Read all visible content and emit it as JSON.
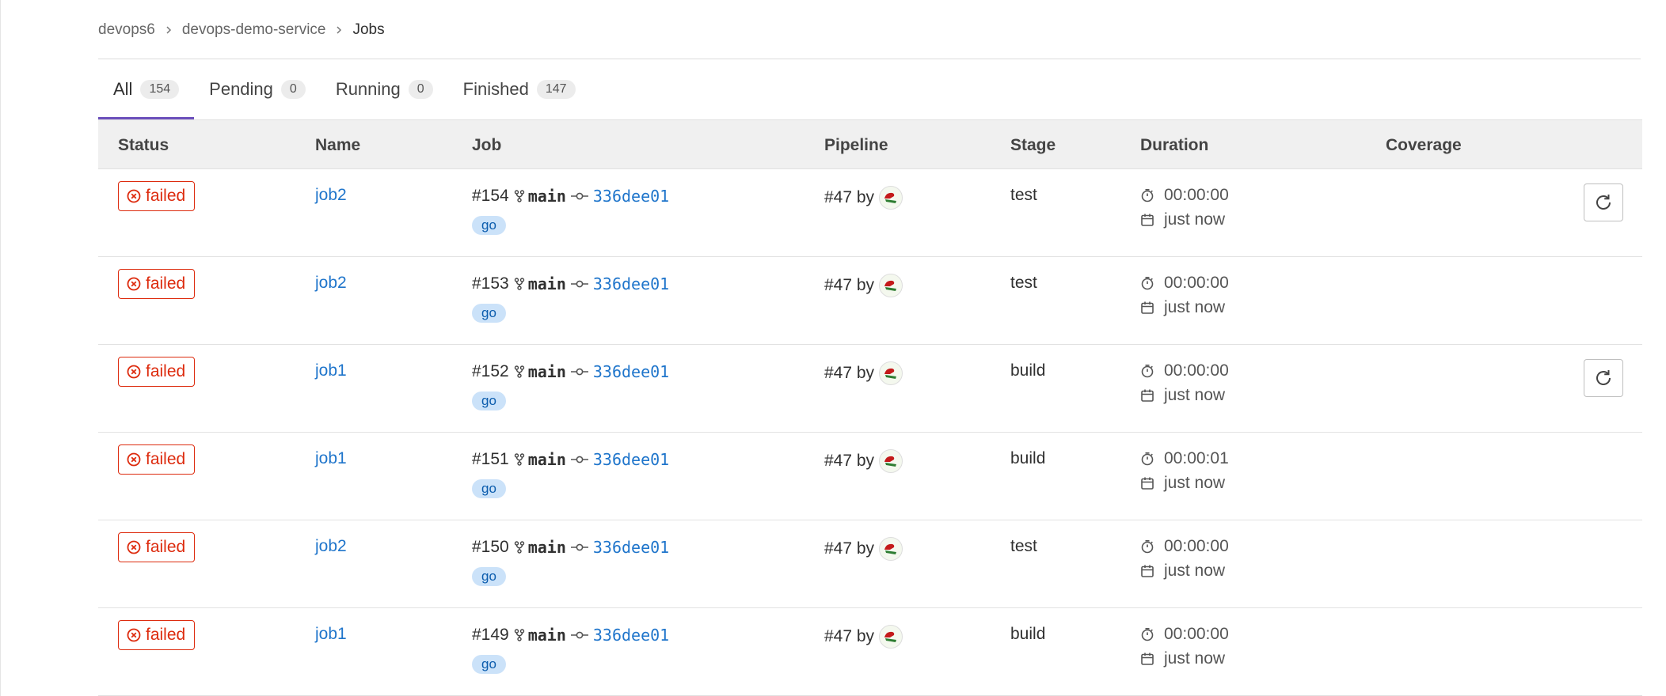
{
  "breadcrumb": [
    "devops6",
    "devops-demo-service",
    "Jobs"
  ],
  "tabs": [
    {
      "label": "All",
      "count": "154"
    },
    {
      "label": "Pending",
      "count": "0"
    },
    {
      "label": "Running",
      "count": "0"
    },
    {
      "label": "Finished",
      "count": "147"
    }
  ],
  "columns": {
    "status": "Status",
    "name": "Name",
    "job": "Job",
    "pipeline": "Pipeline",
    "stage": "Stage",
    "duration": "Duration",
    "coverage": "Coverage"
  },
  "rows": [
    {
      "status": "failed",
      "name": "job2",
      "id": "#154",
      "ref": "main",
      "sha": "336dee01",
      "tag": "go",
      "pipeline": "#47 by",
      "stage": "test",
      "duration": "00:00:00",
      "finished": "just now",
      "retry": true
    },
    {
      "status": "failed",
      "name": "job2",
      "id": "#153",
      "ref": "main",
      "sha": "336dee01",
      "tag": "go",
      "pipeline": "#47 by",
      "stage": "test",
      "duration": "00:00:00",
      "finished": "just now",
      "retry": false
    },
    {
      "status": "failed",
      "name": "job1",
      "id": "#152",
      "ref": "main",
      "sha": "336dee01",
      "tag": "go",
      "pipeline": "#47 by",
      "stage": "build",
      "duration": "00:00:00",
      "finished": "just now",
      "retry": true
    },
    {
      "status": "failed",
      "name": "job1",
      "id": "#151",
      "ref": "main",
      "sha": "336dee01",
      "tag": "go",
      "pipeline": "#47 by",
      "stage": "build",
      "duration": "00:00:01",
      "finished": "just now",
      "retry": false
    },
    {
      "status": "failed",
      "name": "job2",
      "id": "#150",
      "ref": "main",
      "sha": "336dee01",
      "tag": "go",
      "pipeline": "#47 by",
      "stage": "test",
      "duration": "00:00:00",
      "finished": "just now",
      "retry": false
    },
    {
      "status": "failed",
      "name": "job1",
      "id": "#149",
      "ref": "main",
      "sha": "336dee01",
      "tag": "go",
      "pipeline": "#47 by",
      "stage": "build",
      "duration": "00:00:00",
      "finished": "just now",
      "retry": false
    }
  ],
  "icons": {
    "status": "failed-circle-x-icon",
    "ref": "branch-icon",
    "commit": "commit-icon",
    "duration": "timer-icon",
    "finished": "calendar-icon",
    "retry": "retry-icon",
    "separator": "chevron-right-icon"
  },
  "colors": {
    "failed": "#dd2b0e",
    "link": "#1f75cb",
    "active_tab": "#6b4fbb",
    "tag_bg": "#cbe2f9"
  }
}
